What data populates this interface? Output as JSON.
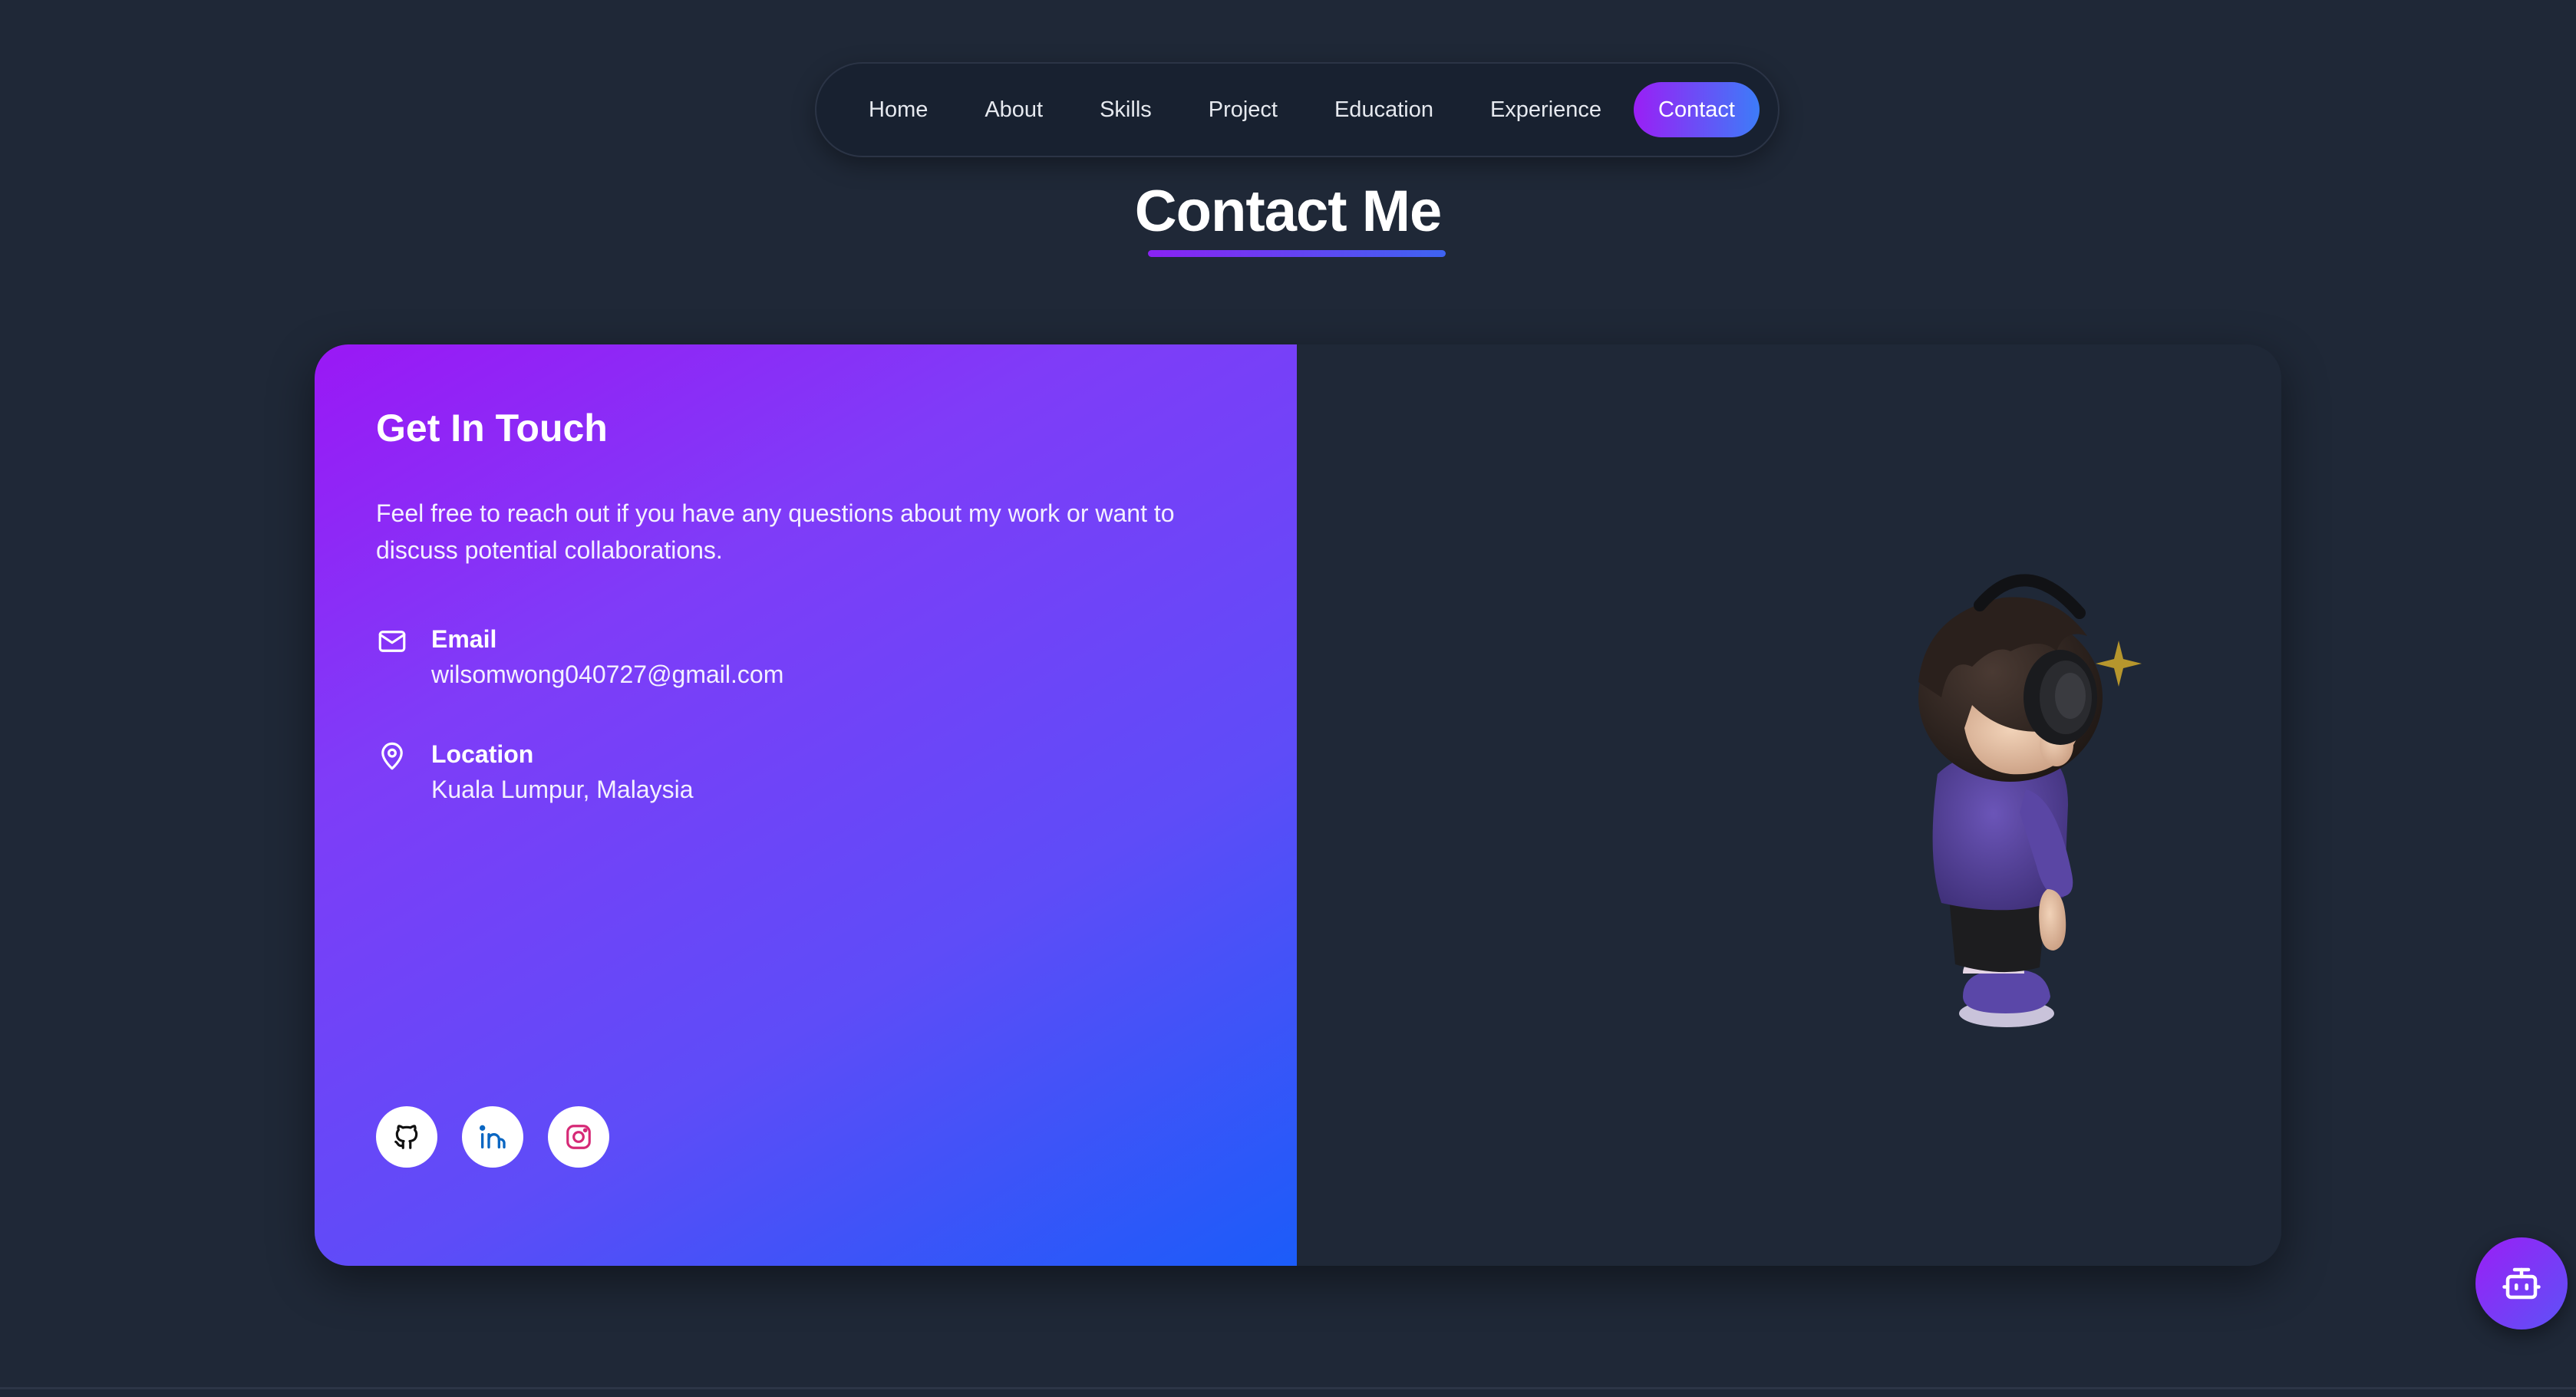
{
  "nav": {
    "items": [
      {
        "label": "Home"
      },
      {
        "label": "About"
      },
      {
        "label": "Skills"
      },
      {
        "label": "Project"
      },
      {
        "label": "Education"
      },
      {
        "label": "Experience"
      },
      {
        "label": "Contact",
        "active": true
      }
    ]
  },
  "section": {
    "title": "Contact Me"
  },
  "contact_card": {
    "heading": "Get In Touch",
    "description": "Feel free to reach out if you have any questions about my work or want to discuss potential collaborations.",
    "email": {
      "icon": "mail-icon",
      "label": "Email",
      "value": "wilsomwong040727@gmail.com"
    },
    "location": {
      "icon": "map-pin-icon",
      "label": "Location",
      "value": "Kuala Lumpur, Malaysia"
    },
    "socials": [
      {
        "name": "github-icon",
        "color": "#111111"
      },
      {
        "name": "linkedin-icon",
        "color": "#0a66c2"
      },
      {
        "name": "instagram-icon",
        "color": "#d62976"
      }
    ]
  },
  "fab": {
    "icon": "robot-icon"
  },
  "colors": {
    "background": "#1f2837",
    "accent_start": "#9a1ff5",
    "accent_end": "#3d7cf8"
  }
}
